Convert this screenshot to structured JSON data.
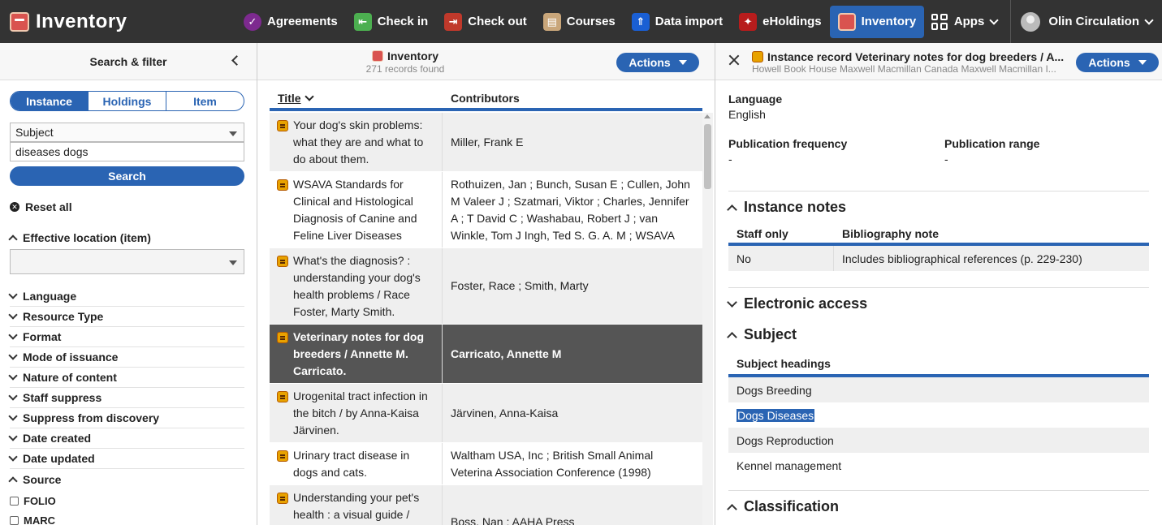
{
  "topbar": {
    "brand": "Inventory",
    "apps": [
      {
        "label": "Agreements",
        "icon": "agreements-icon"
      },
      {
        "label": "Check in",
        "icon": "check-in-icon"
      },
      {
        "label": "Check out",
        "icon": "check-out-icon"
      },
      {
        "label": "Courses",
        "icon": "courses-icon"
      },
      {
        "label": "Data import",
        "icon": "data-import-icon"
      },
      {
        "label": "eHoldings",
        "icon": "eholdings-icon"
      },
      {
        "label": "Inventory",
        "icon": "inventory-icon",
        "active": true
      }
    ],
    "apps_menu": "Apps",
    "user": "Olin Circulation",
    "active_color": "#2a64b3"
  },
  "filter": {
    "title": "Search & filter",
    "segments": [
      "Instance",
      "Holdings",
      "Item"
    ],
    "selected_segment": "Instance",
    "search_field": "Subject",
    "search_value": "diseases dogs",
    "search_button": "Search",
    "reset": "Reset all",
    "effective_location": "Effective location (item)",
    "facets": [
      "Language",
      "Resource Type",
      "Format",
      "Mode of issuance",
      "Nature of content",
      "Staff suppress",
      "Suppress from discovery",
      "Date created",
      "Date updated",
      "Source"
    ],
    "source_options": [
      "FOLIO",
      "MARC"
    ]
  },
  "results": {
    "title": "Inventory",
    "count": "271 records found",
    "actions": "Actions",
    "columns": {
      "title": "Title",
      "contributors": "Contributors"
    },
    "rows": [
      {
        "title": "Your dog's skin problems: what they are and what to do about them.",
        "contributors": "Miller, Frank E"
      },
      {
        "title": "WSAVA Standards for Clinical and Histological Diagnosis of Canine and Feline Liver Diseases",
        "contributors": "Rothuizen, Jan ; Bunch, Susan E ; Cullen, John M Valeer J ; Szatmari, Viktor ; Charles, Jennifer A ; T David C ; Washabau, Robert J ; van Winkle, Tom J Ingh, Ted S. G. A. M ; WSAVA Liver Standardization"
      },
      {
        "title": "What's the diagnosis? : understanding your dog's health problems / Race Foster, Marty Smith.",
        "contributors": "Foster, Race ; Smith, Marty"
      },
      {
        "title": "Veterinary notes for dog breeders / Annette M. Carricato.",
        "contributors": "Carricato, Annette M",
        "selected": true
      },
      {
        "title": "Urogenital tract infection in the bitch / by Anna-Kaisa Järvinen.",
        "contributors": "Järvinen, Anna-Kaisa"
      },
      {
        "title": "Urinary tract disease in dogs and cats.",
        "contributors": "Waltham USA, Inc ; British Small Animal Veterina Association Conference (1998)"
      },
      {
        "title": "Understanding your pet's health : a visual guide /",
        "contributors": "Boss, Nan ; AAHA Press"
      }
    ]
  },
  "detail": {
    "title": "Instance record Veterinary notes for dog breeders / A...",
    "subtitle": "Howell Book House Maxwell Macmillan Canada Maxwell Macmillan I...",
    "actions": "Actions",
    "language_label": "Language",
    "language_value": "English",
    "pub_freq_label": "Publication frequency",
    "pub_freq_value": "-",
    "pub_range_label": "Publication range",
    "pub_range_value": "-",
    "instance_notes": {
      "heading": "Instance notes",
      "col1": "Staff only",
      "col2": "Bibliography note",
      "row_staff": "No",
      "row_note": "Includes bibliographical references (p. 229-230)"
    },
    "electronic_access": "Electronic access",
    "subject": {
      "heading": "Subject",
      "column": "Subject headings",
      "items": [
        "Dogs Breeding",
        "Dogs Diseases",
        "Dogs Reproduction",
        "Kennel management"
      ],
      "highlighted_index": 1
    },
    "classification": "Classification"
  }
}
